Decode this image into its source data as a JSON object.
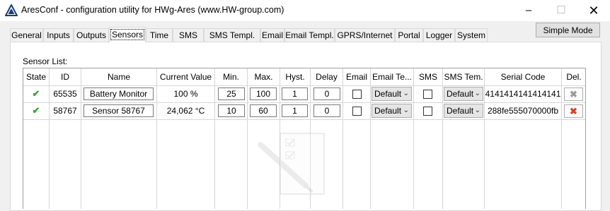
{
  "window": {
    "title": "AresConf - configuration utility for HWg-Ares (www.HW-group.com)",
    "minimize": "–",
    "maximize": "☐",
    "close": "✕"
  },
  "toolbar": {
    "simple_mode_label": "Simple Mode"
  },
  "tabs": [
    {
      "label": "General"
    },
    {
      "label": "Inputs"
    },
    {
      "label": "Outputs"
    },
    {
      "label": "Sensors"
    },
    {
      "label": "Time"
    },
    {
      "label": "SMS"
    },
    {
      "label": "SMS Templ."
    },
    {
      "label": "Email"
    },
    {
      "label": "Email Templ."
    },
    {
      "label": "GPRS/Internet"
    },
    {
      "label": "Portal"
    },
    {
      "label": "Logger"
    },
    {
      "label": "System"
    }
  ],
  "active_tab": "Sensors",
  "sensor_list": {
    "label": "Sensor List:",
    "columns": [
      "State",
      "ID",
      "Name",
      "Current Value",
      "Min.",
      "Max.",
      "Hyst.",
      "Delay",
      "Email",
      "Email Te...",
      "SMS",
      "SMS Tem.",
      "Serial Code",
      "Del."
    ],
    "rows": [
      {
        "state_icon": "check-icon",
        "id": "65535",
        "name": "Battery Monitor",
        "current_value": "100 %",
        "min": "25",
        "max": "100",
        "hyst": "1",
        "delay": "0",
        "email": false,
        "email_template": "Default",
        "sms": false,
        "sms_template": "Default",
        "serial_code": "4141414141414141",
        "delete_enabled": false
      },
      {
        "state_icon": "check-icon",
        "id": "58767",
        "name": "Sensor 58767",
        "current_value": "24,062 °C",
        "min": "10",
        "max": "60",
        "hyst": "1",
        "delay": "0",
        "email": false,
        "email_template": "Default",
        "sms": false,
        "sms_template": "Default",
        "serial_code": "288fe555070000fb",
        "delete_enabled": true
      }
    ]
  },
  "colors": {
    "check": "#3aa13a",
    "delete_active": "#d9432a",
    "delete_disabled": "#9a9a9a"
  }
}
